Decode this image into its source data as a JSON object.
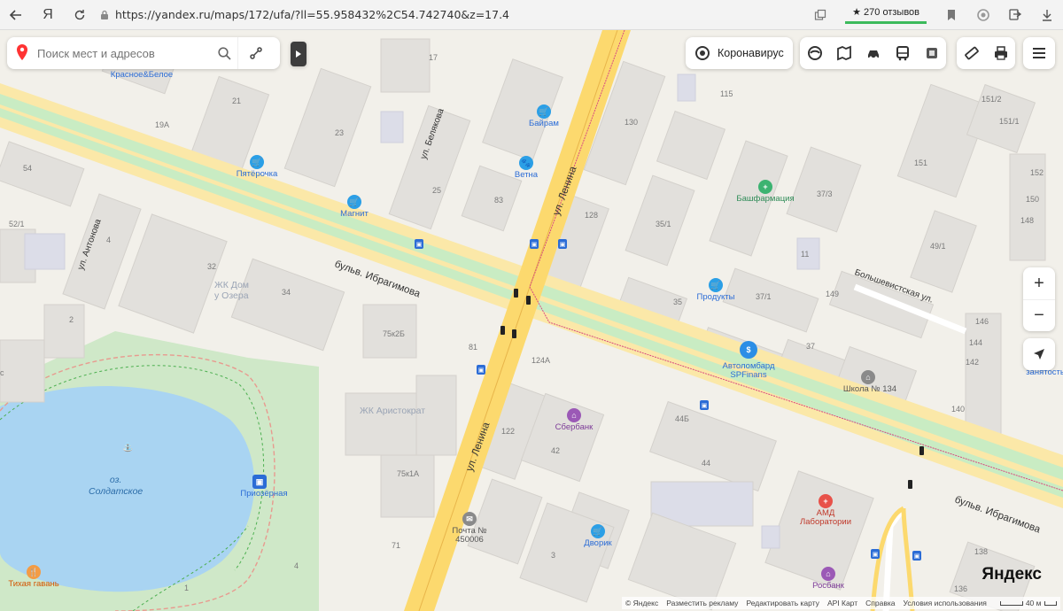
{
  "browser": {
    "url": "https://yandex.ru/maps/172/ufa/?ll=55.958432%2C54.742740&z=17.4",
    "yandex_glyph": "Я",
    "reviews": "★ 270 отзывов"
  },
  "search": {
    "placeholder": "Поиск мест и адресов"
  },
  "toolbar": {
    "corona_label": "Коронавирус"
  },
  "zoom": {
    "in": "+",
    "out": "−"
  },
  "footer": {
    "copyright": "© Яндекс",
    "links": [
      "Разместить рекламу",
      "Редактировать карту",
      "API Карт",
      "Справка",
      "Условия использования"
    ],
    "scale": "40 м",
    "logo": "Яндекс"
  },
  "streets": {
    "lenina_top": "ул. Ленина",
    "lenina_bottom": "ул. Ленина",
    "ibragimova_left": "бульв. Ибрагимова",
    "ibragimova_right": "бульв. Ибрагимова",
    "belyakova": "ул. Белякова",
    "antonova": "ул. Антонова",
    "bolshevistskaya": "Большевистская ул."
  },
  "lake": {
    "name_line1": "оз.",
    "name_line2": "Солдатское"
  },
  "complexes": {
    "zhk_dom_line1": "ЖК Дом",
    "zhk_dom_line2": "у Озера",
    "zhk_aristokrat": "ЖК Аристократ"
  },
  "pois": [
    {
      "name": "Красное&Белое",
      "icon": "shop-icon",
      "color": "#2b6cd6"
    },
    {
      "name": "Пятёрочка",
      "icon": "basket-icon",
      "color": "#2b9fe6"
    },
    {
      "name": "Магнит",
      "icon": "basket-icon",
      "color": "#2b9fe6"
    },
    {
      "name": "Байрам",
      "icon": "basket-icon",
      "color": "#2b9fe6"
    },
    {
      "name": "Ветна",
      "icon": "paw-icon",
      "color": "#2b9fe6"
    },
    {
      "name": "Башфармация",
      "icon": "pharmacy-icon",
      "color": "#3cb371"
    },
    {
      "name": "Продукты",
      "icon": "basket-icon",
      "color": "#2b9fe6"
    },
    {
      "name": "Автоломбард SPFinans",
      "icon": "money-icon",
      "color": "#2b8ee6"
    },
    {
      "name": "Школа № 134",
      "icon": "school-icon",
      "color": "#8a8a8a"
    },
    {
      "name": "Сбербанк",
      "icon": "bank-icon",
      "color": "#9b59b6"
    },
    {
      "name": "Дворик",
      "icon": "basket-icon",
      "color": "#2b9fe6"
    },
    {
      "name": "АМД Лаборатории",
      "icon": "medical-icon",
      "color": "#e8524a"
    },
    {
      "name": "Росбанк",
      "icon": "bank-icon",
      "color": "#9b59b6"
    },
    {
      "name": "Почта № 450006",
      "icon": "mail-icon",
      "color": "#8a8a8a"
    },
    {
      "name": "Приозёрная",
      "icon": "bus-stop-icon",
      "color": "#2b6cd6"
    },
    {
      "name": "Тихая гавань",
      "icon": "food-icon",
      "color": "#f39c45"
    },
    {
      "name": "занятость",
      "icon": "office-icon",
      "color": "#2b6cd6"
    }
  ],
  "house_numbers": [
    "17",
    "21",
    "19А",
    "23",
    "25",
    "83",
    "130",
    "128",
    "35/1",
    "115",
    "151/2",
    "151/1",
    "151",
    "37/3",
    "152",
    "150",
    "148",
    "49/1",
    "11",
    "149",
    "37/1",
    "35",
    "37",
    "34",
    "32",
    "54",
    "52/1",
    "4",
    "2",
    "75к2Б",
    "81",
    "124А",
    "44Б",
    "44",
    "122",
    "42",
    "75к1А",
    "71",
    "3",
    "4",
    "1",
    "146",
    "144",
    "142",
    "140",
    "138",
    "136",
    "134",
    "с"
  ]
}
